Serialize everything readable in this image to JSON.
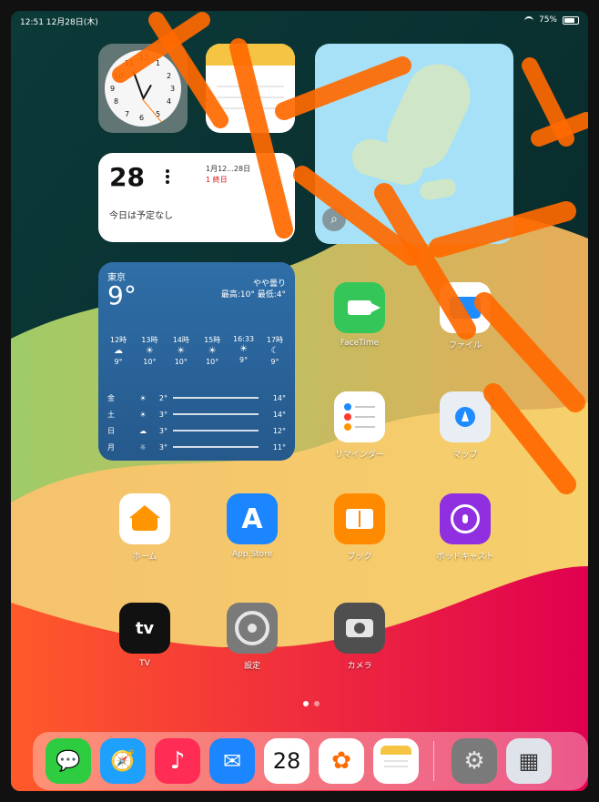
{
  "status_bar": {
    "time_date": "12:51 12月28日(木)",
    "battery": "75%"
  },
  "widgets": {
    "clock": {
      "numbers": [
        "12",
        "11",
        "1",
        "10",
        "2",
        "9",
        "3",
        "8",
        "4",
        "7",
        "5",
        "6"
      ]
    },
    "calendar": {
      "day": "28",
      "header": "1月12...28日",
      "subheader": "1 終日",
      "note": "今日は予定なし"
    },
    "weather": {
      "city": "東京",
      "temp": "9°",
      "desc_line1": "やや曇り",
      "desc_line2": "最高:10° 最低:4°",
      "hourly": [
        {
          "time": "12時",
          "icon": "☁",
          "temp": "9°"
        },
        {
          "time": "13時",
          "icon": "☀",
          "temp": "10°"
        },
        {
          "time": "14時",
          "icon": "☀",
          "temp": "10°"
        },
        {
          "time": "15時",
          "icon": "☀",
          "temp": "10°"
        },
        {
          "time": "16:33",
          "icon": "☀",
          "temp": "9°"
        },
        {
          "time": "17時",
          "icon": "☾",
          "temp": "9°"
        }
      ],
      "days": [
        {
          "day": "金",
          "icon": "☀",
          "low": "2°",
          "high": "14°"
        },
        {
          "day": "土",
          "icon": "☀",
          "low": "3°",
          "high": "14°"
        },
        {
          "day": "日",
          "icon": "☁",
          "low": "3°",
          "high": "12°"
        },
        {
          "day": "月",
          "icon": "☼",
          "low": "3°",
          "high": "11°"
        }
      ]
    },
    "map": {
      "search_icon": "magnifier"
    }
  },
  "apps": [
    {
      "id": "facetime",
      "label": "FaceTime",
      "color": "#35c659"
    },
    {
      "id": "files",
      "label": "ファイル",
      "color": "#1e8cff"
    },
    {
      "id": "reminders",
      "label": "リマインダー",
      "color": "#ffffff"
    },
    {
      "id": "maps",
      "label": "マップ",
      "color": "#e9eef4"
    },
    {
      "id": "home",
      "label": "ホーム",
      "color": "#ffffff"
    },
    {
      "id": "appstore",
      "label": "App Store",
      "color": "#1b86ff"
    },
    {
      "id": "books",
      "label": "ブック",
      "color": "#ff8a00"
    },
    {
      "id": "podcasts",
      "label": "ポッドキャスト",
      "color": "#8f2fe0"
    },
    {
      "id": "tv",
      "label": "TV",
      "color": "#111111"
    },
    {
      "id": "settings",
      "label": "設定",
      "color": "#7a7a7a"
    },
    {
      "id": "camera",
      "label": "カメラ",
      "color": "#4f4f4f"
    }
  ],
  "dock": [
    {
      "id": "messages",
      "color": "#2ecc40",
      "glyph": "💬"
    },
    {
      "id": "safari",
      "color": "#1ea0ff",
      "glyph": "🧭"
    },
    {
      "id": "music",
      "color": "#ff2d55",
      "glyph": "♪"
    },
    {
      "id": "mail",
      "color": "#1b86ff",
      "glyph": "✉"
    },
    {
      "id": "calendar",
      "color": "#ffffff",
      "glyph": "28"
    },
    {
      "id": "photos",
      "color": "#ffffff",
      "glyph": "✿"
    },
    {
      "id": "notes",
      "color": "#ffffff",
      "glyph": ""
    },
    {
      "id": "settings",
      "color": "#7a7a7a",
      "glyph": "⚙"
    },
    {
      "id": "app-library",
      "color": "#dfe3ea",
      "glyph": "▦"
    }
  ]
}
